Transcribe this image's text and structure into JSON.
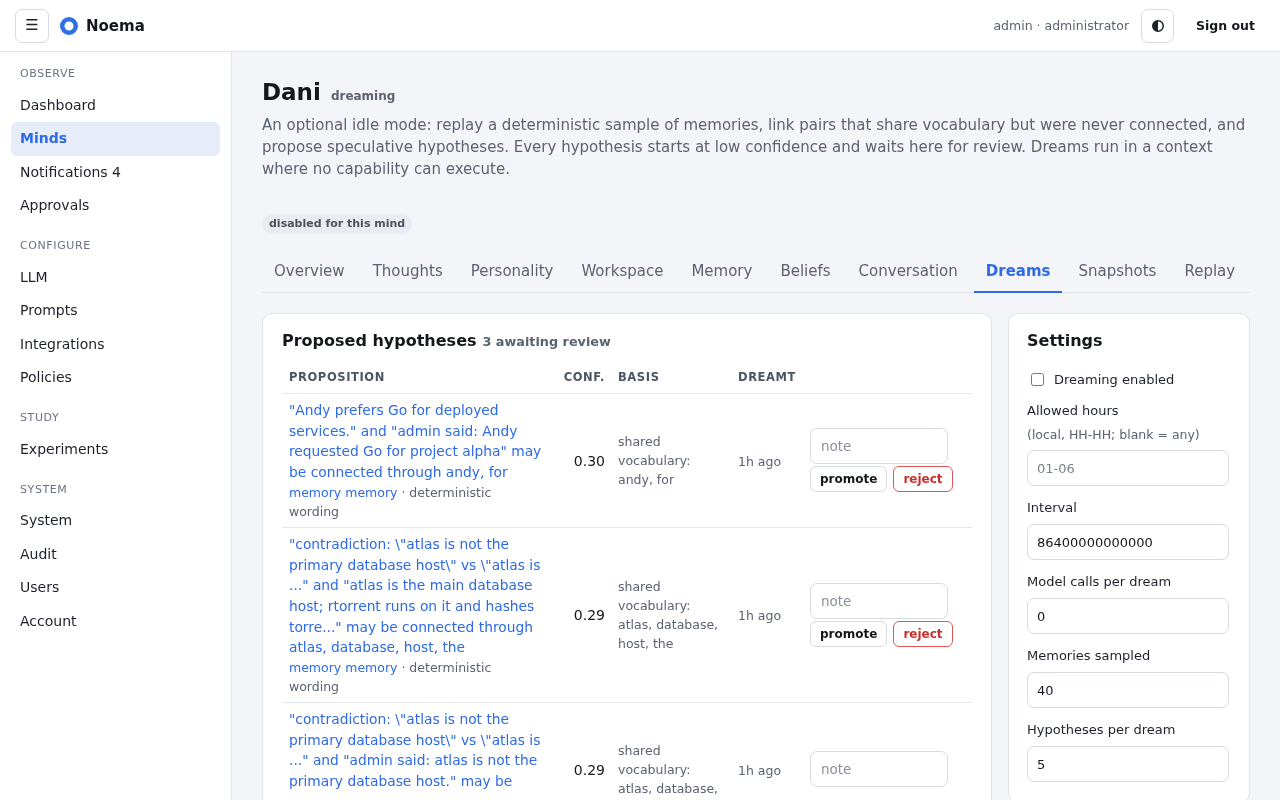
{
  "header": {
    "menu": "☰",
    "brand": "Noema",
    "user": "admin · administrator",
    "sign_out": "Sign out"
  },
  "sidebar": {
    "sections": [
      {
        "heading": "OBSERVE",
        "items": [
          {
            "label": "Dashboard",
            "selected": false
          },
          {
            "label": "Minds",
            "selected": true
          },
          {
            "label": "Notifications 4",
            "selected": false
          },
          {
            "label": "Approvals",
            "selected": false
          }
        ]
      },
      {
        "heading": "CONFIGURE",
        "items": [
          {
            "label": "LLM",
            "selected": false
          },
          {
            "label": "Prompts",
            "selected": false
          },
          {
            "label": "Integrations",
            "selected": false
          },
          {
            "label": "Policies",
            "selected": false
          }
        ]
      },
      {
        "heading": "STUDY",
        "items": [
          {
            "label": "Experiments",
            "selected": false
          }
        ]
      },
      {
        "heading": "SYSTEM",
        "items": [
          {
            "label": "System",
            "selected": false
          },
          {
            "label": "Audit",
            "selected": false
          },
          {
            "label": "Users",
            "selected": false
          },
          {
            "label": "Account",
            "selected": false
          }
        ]
      }
    ]
  },
  "mind": {
    "name": "Dani",
    "status": "dreaming",
    "description": "An optional idle mode: replay a deterministic sample of memories, link pairs that share vocabulary but were never connected, and propose speculative hypotheses. Every hypothesis starts at low confidence and waits here for review. Dreams run in a context where no capability can execute.",
    "badge": "disabled for this mind"
  },
  "tabs": [
    {
      "label": "Overview",
      "selected": false
    },
    {
      "label": "Thoughts",
      "selected": false
    },
    {
      "label": "Personality",
      "selected": false
    },
    {
      "label": "Workspace",
      "selected": false
    },
    {
      "label": "Memory",
      "selected": false
    },
    {
      "label": "Beliefs",
      "selected": false
    },
    {
      "label": "Conversation",
      "selected": false
    },
    {
      "label": "Dreams",
      "selected": true
    },
    {
      "label": "Snapshots",
      "selected": false
    },
    {
      "label": "Replay",
      "selected": false
    }
  ],
  "hypotheses": {
    "title": "Proposed hypotheses",
    "count": "3 awaiting review",
    "columns": [
      "PROPOSITION",
      "CONF.",
      "BASIS",
      "DREAMT"
    ],
    "rows": [
      {
        "proposition": "\"Andy prefers Go for deployed services.\" and \"admin said: Andy requested Go for project alpha\" may be connected through andy, for",
        "sources": [
          "memory",
          "memory"
        ],
        "detail": "· deterministic wording",
        "conf": "0.30",
        "basis": "shared vocabulary: andy, for",
        "dreamt": "1h ago",
        "note_placeholder": "note",
        "actions": [
          {
            "kind": "promote",
            "label": "promote"
          },
          {
            "kind": "reject",
            "label": "reject"
          }
        ]
      },
      {
        "proposition": "\"contradiction: \\\"atlas is not the primary database host\\\" vs \\\"atlas is ...\" and \"atlas is the main database host; rtorrent runs on it and hashes torre...\" may be connected through atlas, database, host, the",
        "sources": [
          "memory",
          "memory"
        ],
        "detail": "· deterministic wording",
        "conf": "0.29",
        "basis": "shared vocabulary: atlas, database, host, the",
        "dreamt": "1h ago",
        "note_placeholder": "note",
        "actions": [
          {
            "kind": "promote",
            "label": "promote"
          },
          {
            "kind": "reject",
            "label": "reject"
          }
        ]
      },
      {
        "proposition": "\"contradiction: \\\"atlas is not the primary database host\\\" vs \\\"atlas is ...\" and \"admin said: atlas is not the primary database host.\" may be",
        "conf": "0.29",
        "basis": "shared vocabulary: atlas, database,",
        "dreamt": "1h ago",
        "note_placeholder": "note"
      }
    ]
  },
  "settings": {
    "title": "Settings",
    "fields": [
      {
        "kind": "checkbox",
        "label": "Dreaming enabled",
        "checked": false
      },
      {
        "kind": "text",
        "label": "Allowed hours",
        "hint": "(local, HH-HH; blank = any)",
        "placeholder": "01-06"
      },
      {
        "kind": "text",
        "label": "Interval",
        "value": "86400000000000"
      },
      {
        "kind": "text",
        "label": "Model calls per dream",
        "value": "0"
      },
      {
        "kind": "text",
        "label": "Memories sampled",
        "value": "40"
      },
      {
        "kind": "text",
        "label": "Hypotheses per dream",
        "value": "5"
      }
    ]
  }
}
